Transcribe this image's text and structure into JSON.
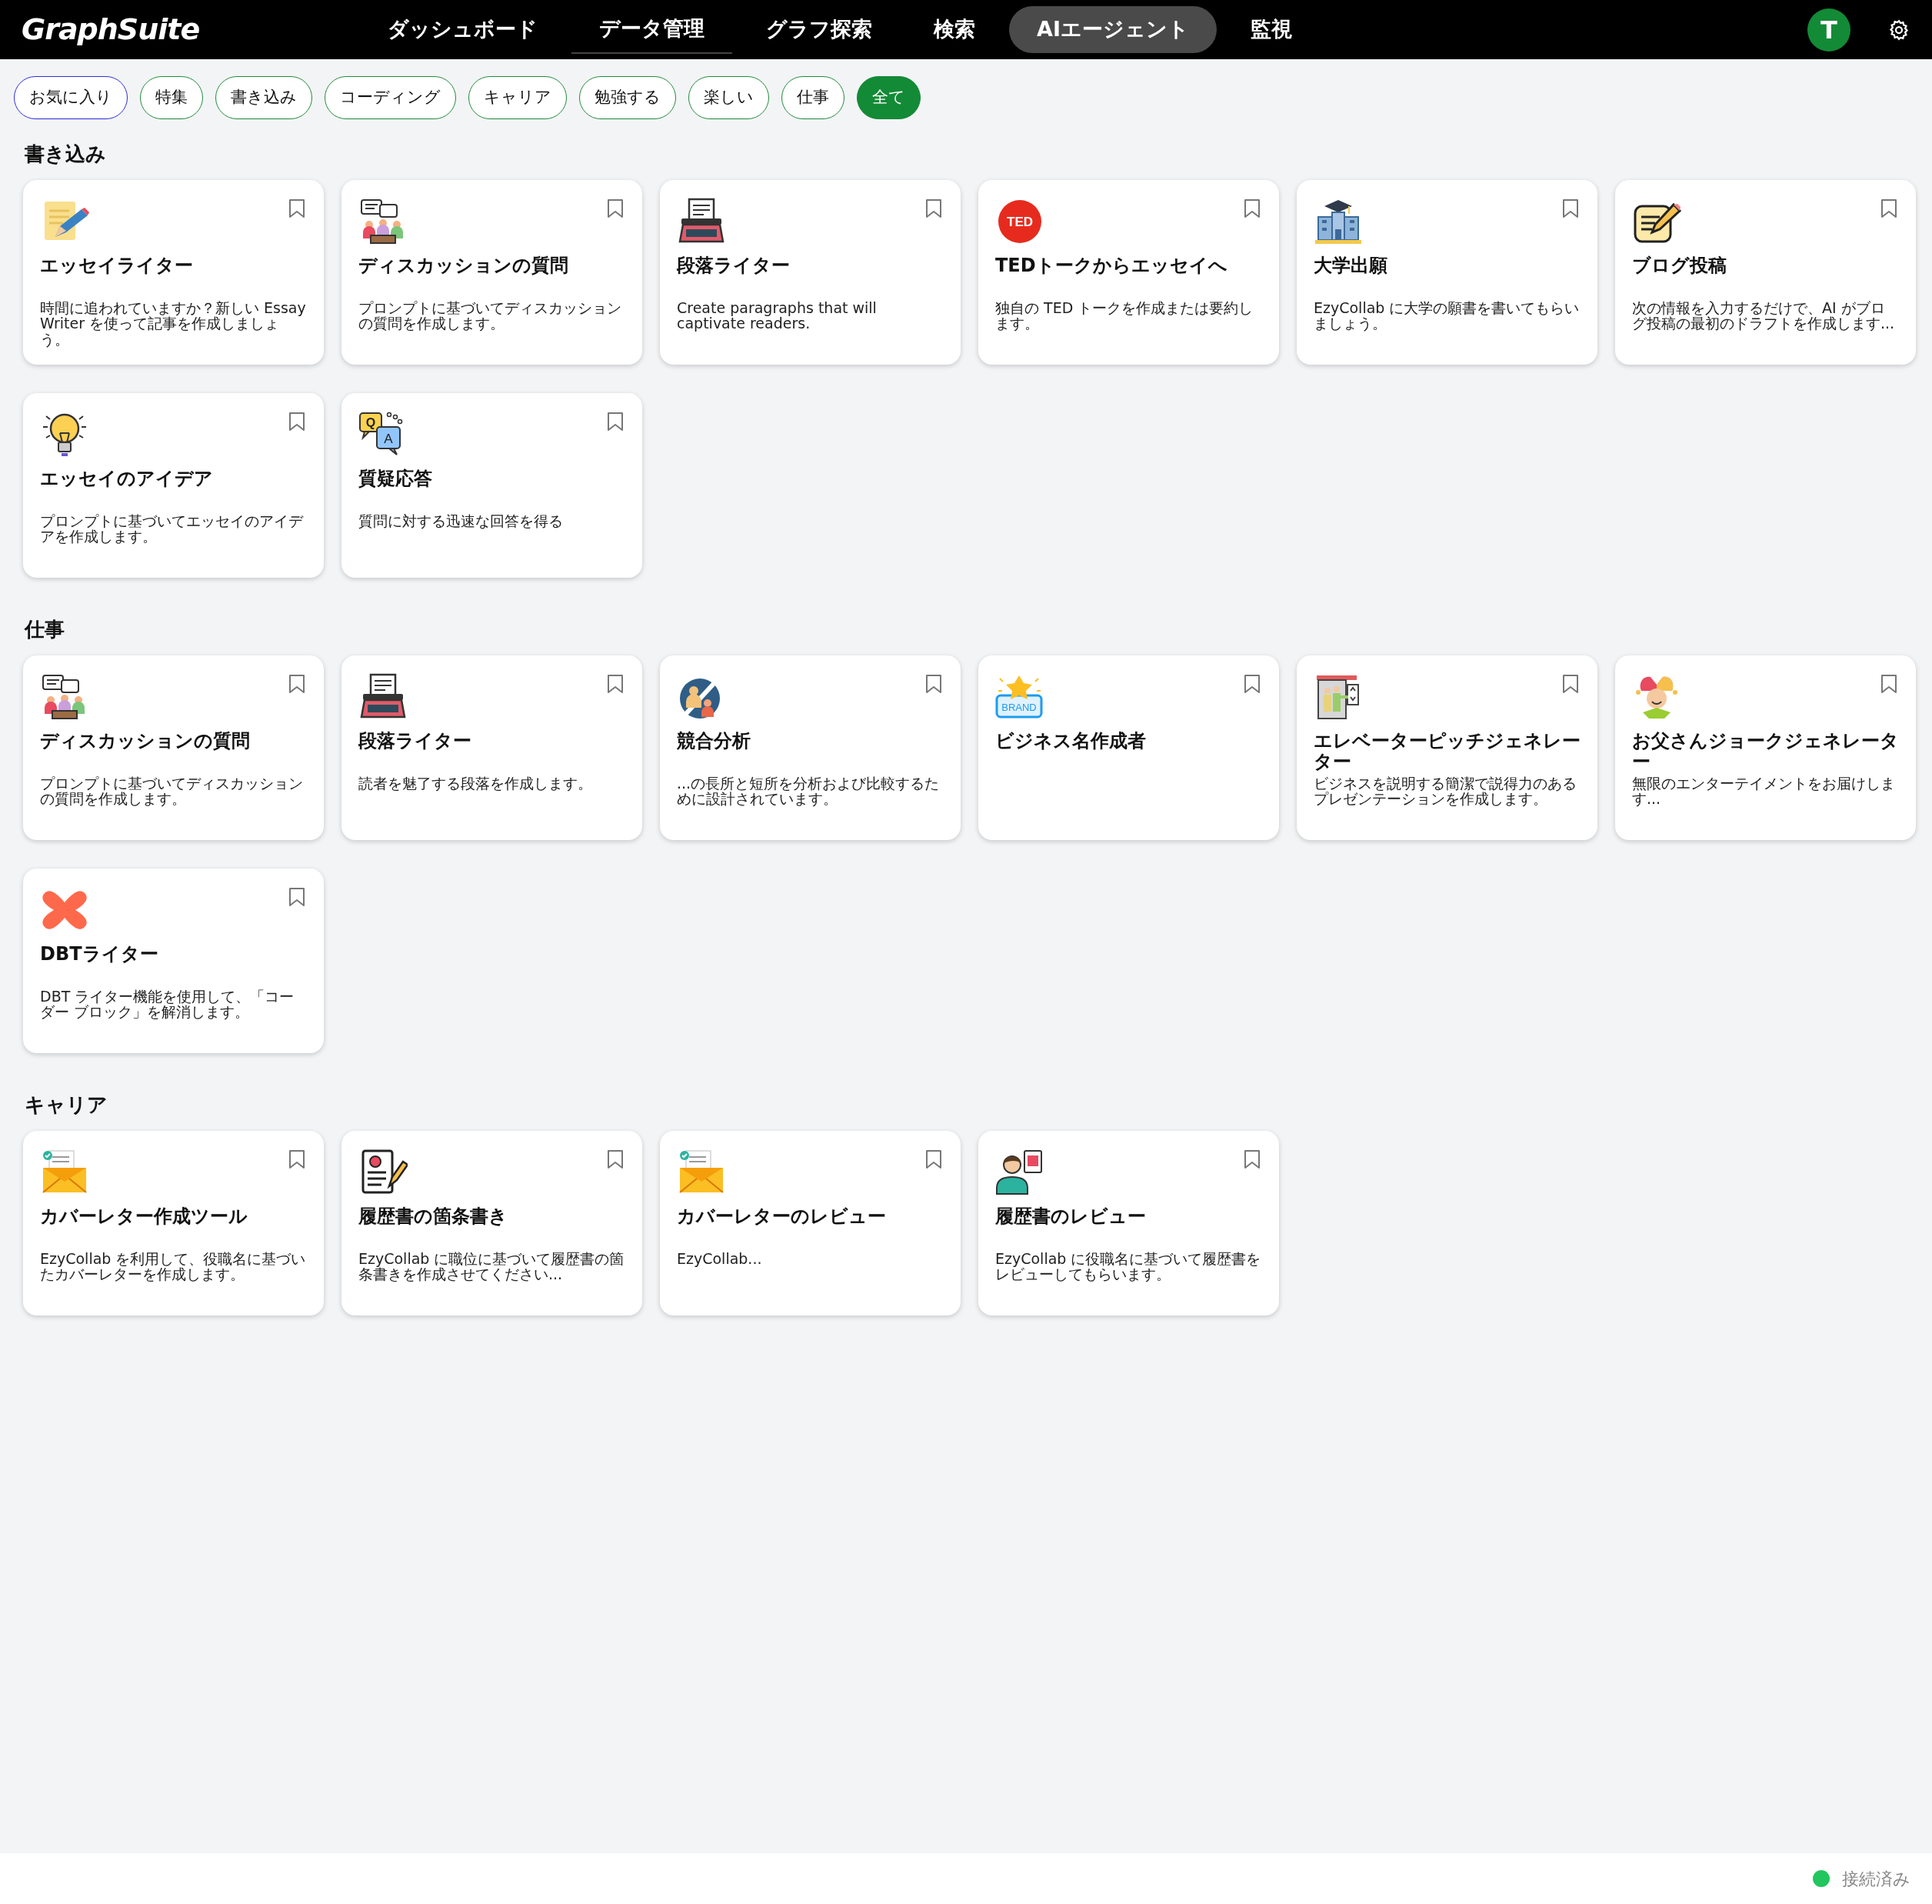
{
  "app": {
    "logo": "GraphSuite",
    "avatar_letter": "T"
  },
  "nav": [
    {
      "label": "ダッシュボード",
      "selected": false,
      "underlined": false
    },
    {
      "label": "データ管理",
      "selected": false,
      "underlined": true
    },
    {
      "label": "グラフ探索",
      "selected": false,
      "underlined": false
    },
    {
      "label": "検索",
      "selected": false,
      "underlined": false
    },
    {
      "label": "AIエージェント",
      "selected": true,
      "underlined": false
    },
    {
      "label": "監視",
      "selected": false,
      "underlined": false
    }
  ],
  "filters": [
    {
      "label": "お気に入り",
      "kind": "favorites",
      "selected": false
    },
    {
      "label": "特集",
      "kind": "category",
      "selected": false
    },
    {
      "label": "書き込み",
      "kind": "category",
      "selected": false
    },
    {
      "label": "コーディング",
      "kind": "category",
      "selected": false
    },
    {
      "label": "キャリア",
      "kind": "category",
      "selected": false
    },
    {
      "label": "勉強する",
      "kind": "category",
      "selected": false
    },
    {
      "label": "楽しい",
      "kind": "category",
      "selected": false
    },
    {
      "label": "仕事",
      "kind": "category",
      "selected": false
    },
    {
      "label": "全て",
      "kind": "category",
      "selected": true
    }
  ],
  "sections": [
    {
      "title": "書き込み",
      "cards": [
        {
          "kind": "note-pencil",
          "title": "エッセイライター",
          "description": "時間に追われていますか？新しい Essay Writer を使って記事を作成しましょう。",
          "bookmarked": false
        },
        {
          "kind": "discussion",
          "title": "ディスカッションの質問",
          "description": "プロンプトに基づいてディスカッションの質問を作成します。",
          "bookmarked": false
        },
        {
          "kind": "typewriter",
          "title": "段落ライター",
          "description": "Create paragraphs that will captivate readers.",
          "bookmarked": false
        },
        {
          "kind": "ted",
          "icon_text": [
            "TED"
          ],
          "title": "TEDトークからエッセイへ",
          "description": "独自の TED トークを作成または要約します。",
          "bookmarked": false
        },
        {
          "kind": "university",
          "title": "大学出願",
          "description": "EzyCollab に大学の願書を書いてもらいましょう。",
          "bookmarked": false
        },
        {
          "kind": "notepad",
          "title": "ブログ投稿",
          "description": "次の情報を入力するだけで、AI がブログ投稿の最初のドラフトを作成します...",
          "bookmarked": false
        },
        {
          "kind": "lightbulb",
          "title": "エッセイのアイデア",
          "description": "プロンプトに基づいてエッセイのアイデアを作成します。",
          "bookmarked": false
        },
        {
          "kind": "qa",
          "icon_text": [
            "Q",
            "A"
          ],
          "title": "質疑応答",
          "description": "質問に対する迅速な回答を得る",
          "bookmarked": false
        }
      ]
    },
    {
      "title": "仕事",
      "cards": [
        {
          "kind": "discussion",
          "title": "ディスカッションの質問",
          "description": "プロンプトに基づいてディスカッションの質問を作成します。",
          "bookmarked": false
        },
        {
          "kind": "typewriter",
          "title": "段落ライター",
          "description": "読者を魅了する段落を作成します。",
          "bookmarked": false
        },
        {
          "kind": "competitors",
          "title": "競合分析",
          "description": "...の長所と短所を分析および比較するために設計されています。",
          "bookmarked": false
        },
        {
          "kind": "brand",
          "icon_text": [
            "BRAND"
          ],
          "title": "ビジネス名作成者",
          "bookmarked": false
        },
        {
          "kind": "elevator",
          "title": "エレベーターピッチジェネレーター",
          "description": "ビジネスを説明する簡潔で説得力のあるプレゼンテーションを作成します。",
          "bookmarked": false
        },
        {
          "kind": "jester",
          "title": "お父さんジョークジェネレーター",
          "description": "無限のエンターテイメントをお届けします...",
          "bookmarked": false
        },
        {
          "kind": "dbt",
          "title": "DBTライター",
          "description": "DBT ライター機能を使用して、「コーダー ブロック」を解消します。",
          "bookmarked": false
        }
      ]
    },
    {
      "title": "キャリア",
      "cards": [
        {
          "kind": "envelope",
          "title": "カバーレター作成ツール",
          "description": "EzyCollab を利用して、役職名に基づいたカバーレターを作成します。",
          "bookmarked": false
        },
        {
          "kind": "resume",
          "title": "履歴書の箇条書き",
          "description": "EzyCollab に職位に基づいて履歴書の箇条書きを作成させてください...",
          "bookmarked": false
        },
        {
          "kind": "envelope",
          "title": "カバーレターのレビュー",
          "description": "EzyCollab...",
          "bookmarked": false
        },
        {
          "kind": "reviewer",
          "title": "履歴書のレビュー",
          "description": "EzyCollab に役職名に基づいて履歴書をレビューしてもらいます。",
          "bookmarked": false
        }
      ]
    }
  ],
  "status_bar": {
    "connected": true,
    "label": "接続済み"
  }
}
